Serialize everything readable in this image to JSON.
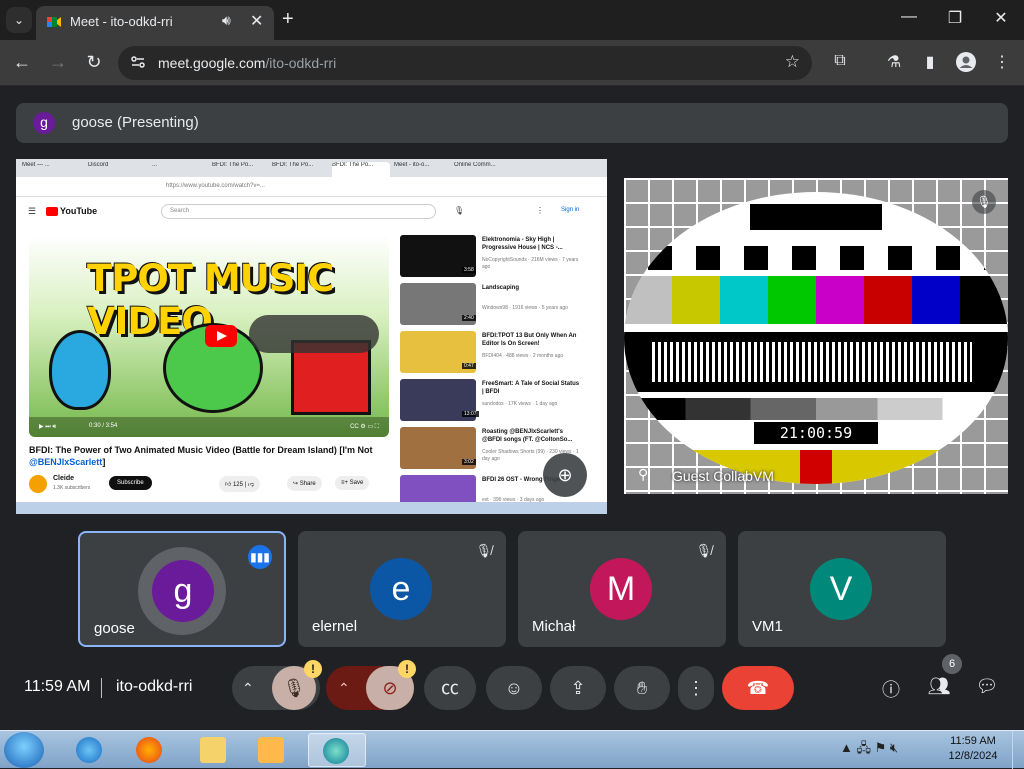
{
  "browser": {
    "tab_title": "Meet - ito-odkd-rri",
    "tab_audio_icon": "speaker-icon",
    "tab_close_icon": "close-icon",
    "new_tab_icon": "plus-icon",
    "url_host": "meet.google.com",
    "url_path": "/ito-odkd-rri"
  },
  "presentation": {
    "avatar_letter": "g",
    "label": "goose (Presenting)"
  },
  "shared_screen": {
    "tabs": [
      "Meet — ...",
      "Discord",
      "...",
      "BFDI: The Po...",
      "BFDI: The Po...",
      "BFDI: The Po...",
      "Meet - ito-o...",
      "Online Comm..."
    ],
    "url": "https://www.youtube.com/watch?v=...",
    "yt_logo": "YouTube",
    "search_placeholder": "Search",
    "sign_in": "Sign in",
    "video_overlay_title": "TPOT MUSIC VIDEO",
    "time": "0:30 / 3:54",
    "video_title": "BFDI: The Power of Two Animated Music Video (Battle for Dream Island) [I'm Not",
    "video_title_link": "@BENJIxScarlett",
    "video_title_end": "]",
    "channel_name": "Cleide",
    "channel_subs": "1.3K subscribers",
    "subscribe": "Subscribe",
    "likes": "125",
    "share": "Share",
    "save": "Save",
    "recommendations": [
      {
        "title": "Elektronomia - Sky High | Progressive House | NCS -...",
        "meta": "NoCopyrightSounds · 216M views · 7 years ago",
        "dur": "3:58"
      },
      {
        "title": "Landscaping",
        "meta": "Windows98 · 1916 views · 5 years ago",
        "dur": "2:40"
      },
      {
        "title": "BFDI:TPOT 13 But Only When An Editor Is On Screen!",
        "meta": "BFDI404 · 488 views · 2 months ago",
        "dur": "0:47"
      },
      {
        "title": "FreeSmart: A Tale of Social Status | BFDI",
        "meta": "sundodos · 17K views · 1 day ago",
        "dur": "13:07"
      },
      {
        "title": "Roasting @BENJIxScarlett's @BFDI songs (FT. @ColtonSo...",
        "meta": "Cooler Shadows Shorts (99) · 230 views · 1 day ago",
        "dur": "3:02"
      },
      {
        "title": "BFDI 26 OST - Wrong Finger",
        "meta": "ext · 396 views · 3 days ago",
        "dur": ""
      }
    ]
  },
  "guest_tile": {
    "name": "Guest CollabVM",
    "clock": "21:00:59"
  },
  "participants": [
    {
      "letter": "g",
      "name": "goose",
      "color": "#6a1b9a",
      "state": "speaking"
    },
    {
      "letter": "e",
      "name": "elernel",
      "color": "#0b57a5",
      "state": "muted"
    },
    {
      "letter": "M",
      "name": "Michał",
      "color": "#c2185b",
      "state": "muted"
    },
    {
      "letter": "V",
      "name": "VM1",
      "color": "#00897b",
      "state": "none"
    }
  ],
  "bottom_bar": {
    "time": "11:59 AM",
    "meeting_code": "ito-odkd-rri",
    "warning_glyph": "!",
    "people_count": "6"
  },
  "taskbar": {
    "clock_time": "11:59 AM",
    "clock_date": "12/8/2024"
  },
  "colors": {
    "meet_bg": "#202124",
    "tile_bg": "#3c4043",
    "end_call": "#ea4335",
    "accent": "#8ab4f8"
  }
}
